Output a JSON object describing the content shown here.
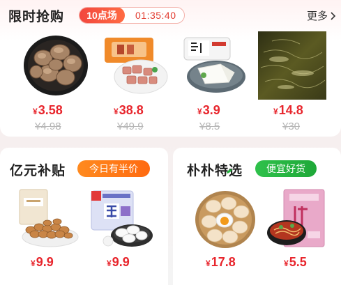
{
  "flash_sale": {
    "title": "限时抢购",
    "session": "10点场",
    "countdown": "01:35:40",
    "more": "更多",
    "currency": "¥",
    "products": [
      {
        "price": "3.58",
        "original": "¥4.98",
        "image": "shiitake-mushrooms"
      },
      {
        "price": "38.8",
        "original": "¥49.9",
        "image": "pork-ribs-pack"
      },
      {
        "price": "3.9",
        "original": "¥8.5",
        "image": "tofu-plate"
      },
      {
        "price": "14.8",
        "original": "¥30",
        "image": "shrimp-photo"
      }
    ]
  },
  "subsidy": {
    "title": "亿元补贴",
    "badge": "今日有半价",
    "currency": "¥",
    "products": [
      {
        "price": "9.9",
        "image": "almonds-bag"
      },
      {
        "price": "9.9",
        "image": "fresh-dumplings"
      }
    ]
  },
  "puput": {
    "title": "朴朴特选",
    "badge": "便宜好货",
    "currency": "¥",
    "products": [
      {
        "price": "17.8",
        "image": "eggs-basket"
      },
      {
        "price": "5.5",
        "image": "noodles-pack"
      }
    ]
  },
  "colors": {
    "accent": "#e8262d",
    "orange": "#ff7a1a",
    "green": "#23b33f"
  }
}
